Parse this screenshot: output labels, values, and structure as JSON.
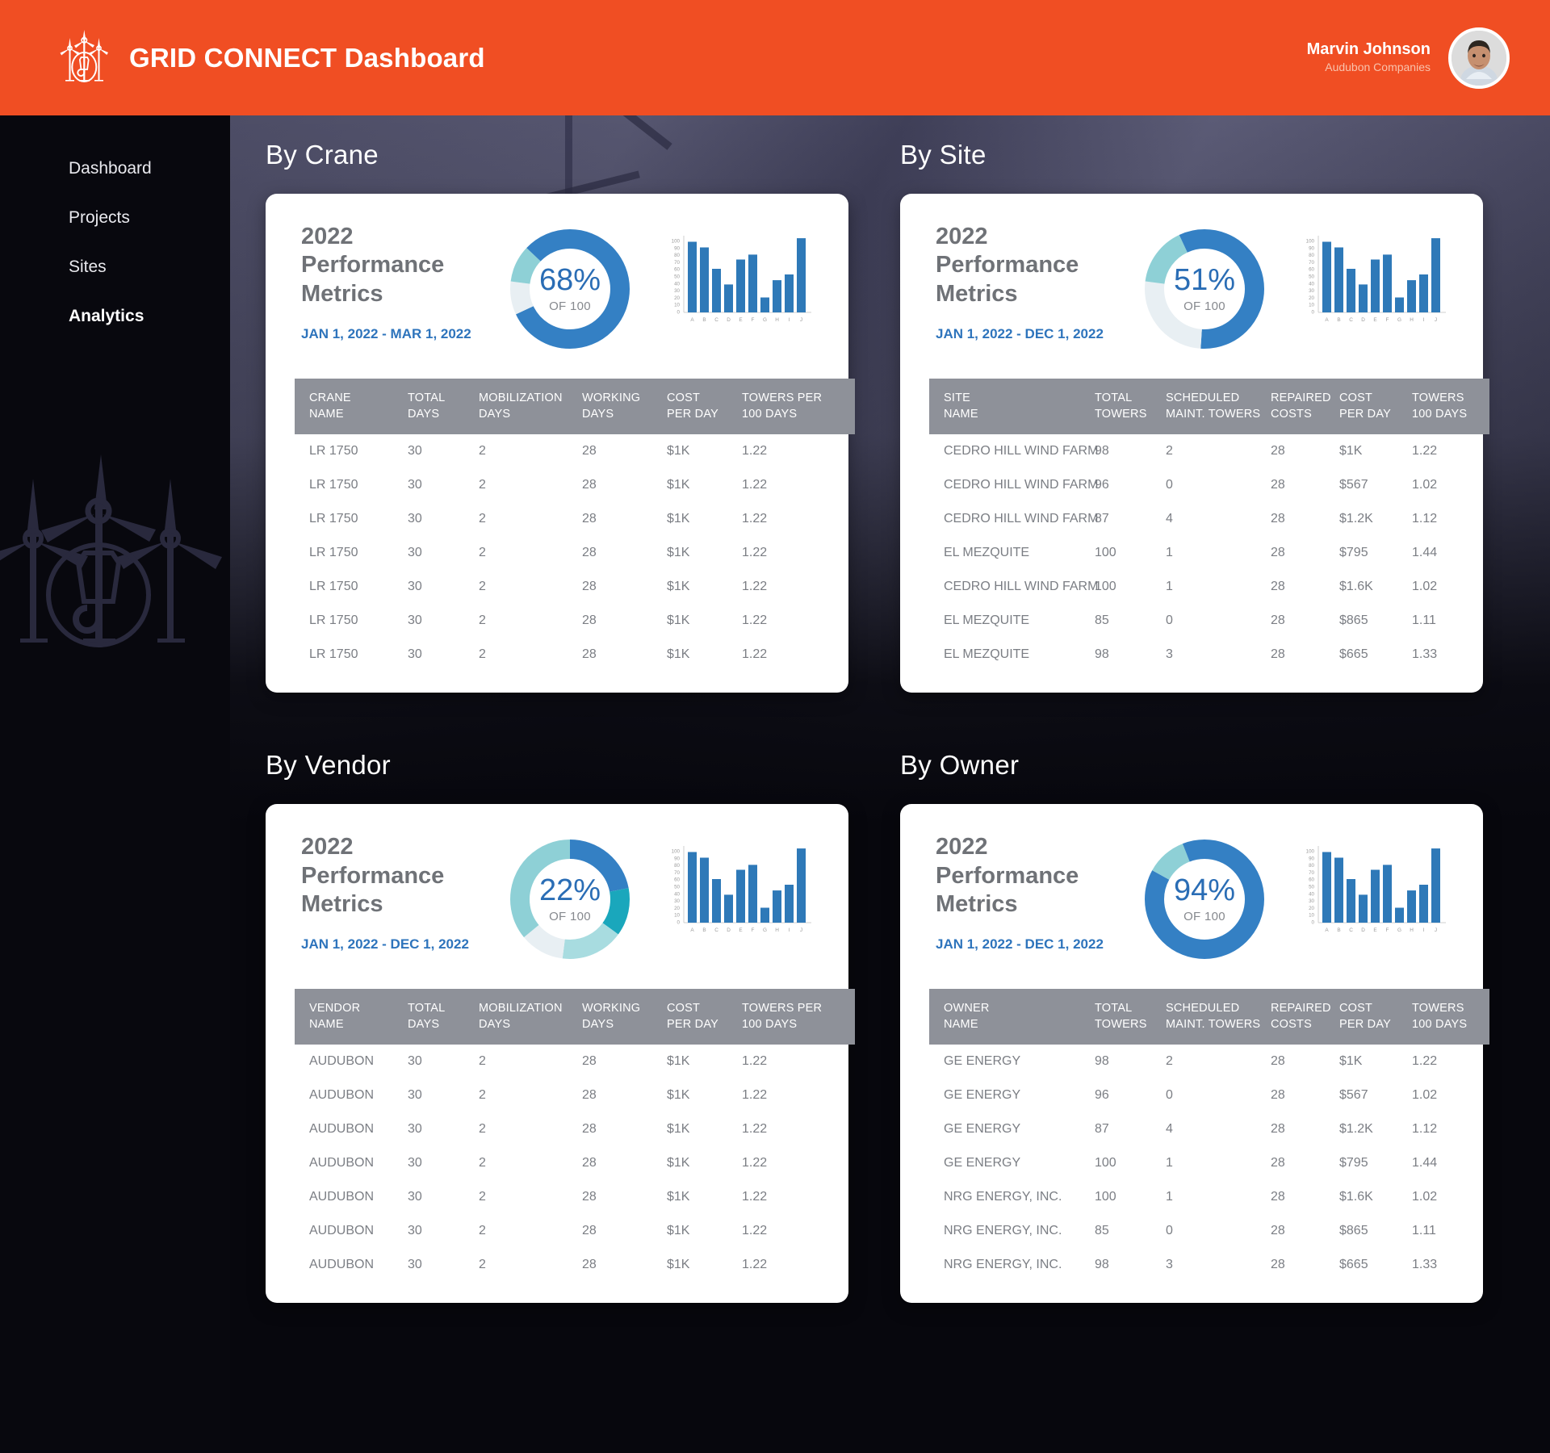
{
  "header": {
    "title": "GRID CONNECT Dashboard",
    "logo_icon": "wind-turbine-crane-logo",
    "user_name": "Marvin Johnson",
    "user_org": "Audubon Companies",
    "avatar_icon": "user-avatar-photo",
    "accent_color": "#f04e23"
  },
  "sidebar": {
    "items": [
      {
        "label": "Dashboard",
        "active": false
      },
      {
        "label": "Projects",
        "active": false
      },
      {
        "label": "Sites",
        "active": false
      },
      {
        "label": "Analytics",
        "active": true
      }
    ],
    "watermark_icon": "wind-turbine-crane-watermark"
  },
  "sections": {
    "crane": "By Crane",
    "site": "By Site",
    "vendor": "By Vendor",
    "owner": "By Owner"
  },
  "cards": {
    "crane": {
      "heading_line1": "2022",
      "heading_line2": "Performance",
      "heading_line3": "Metrics",
      "date_range": "JAN 1, 2022 - MAR 1, 2022",
      "donut_pct": "68%",
      "donut_sub": "OF 100",
      "columns": [
        {
          "l1": "CRANE",
          "l2": "NAME"
        },
        {
          "l1": "TOTAL",
          "l2": "DAYS"
        },
        {
          "l1": "MOBILIZATION",
          "l2": "DAYS"
        },
        {
          "l1": "WORKING",
          "l2": "DAYS"
        },
        {
          "l1": "COST",
          "l2": "PER DAY"
        },
        {
          "l1": "TOWERS PER",
          "l2": "100 DAYS"
        }
      ],
      "rows": [
        [
          "LR 1750",
          "30",
          "2",
          "28",
          "$1K",
          "1.22"
        ],
        [
          "LR 1750",
          "30",
          "2",
          "28",
          "$1K",
          "1.22"
        ],
        [
          "LR 1750",
          "30",
          "2",
          "28",
          "$1K",
          "1.22"
        ],
        [
          "LR 1750",
          "30",
          "2",
          "28",
          "$1K",
          "1.22"
        ],
        [
          "LR 1750",
          "30",
          "2",
          "28",
          "$1K",
          "1.22"
        ],
        [
          "LR 1750",
          "30",
          "2",
          "28",
          "$1K",
          "1.22"
        ],
        [
          "LR 1750",
          "30",
          "2",
          "28",
          "$1K",
          "1.22"
        ]
      ]
    },
    "site": {
      "heading_line1": "2022",
      "heading_line2": "Performance",
      "heading_line3": "Metrics",
      "date_range": "JAN 1, 2022 - DEC 1, 2022",
      "donut_pct": "51%",
      "donut_sub": "OF 100",
      "columns": [
        {
          "l1": "SITE",
          "l2": "NAME"
        },
        {
          "l1": "TOTAL",
          "l2": "TOWERS"
        },
        {
          "l1": "SCHEDULED",
          "l2": "MAINT. TOWERS"
        },
        {
          "l1": "REPAIRED",
          "l2": "COSTS"
        },
        {
          "l1": "COST",
          "l2": "PER DAY"
        },
        {
          "l1": "TOWERS",
          "l2": "100 DAYS"
        }
      ],
      "rows": [
        [
          "CEDRO HILL WIND FARM",
          "98",
          "2",
          "28",
          "$1K",
          "1.22"
        ],
        [
          "CEDRO HILL WIND FARM",
          "96",
          "0",
          "28",
          "$567",
          "1.02"
        ],
        [
          "CEDRO HILL WIND FARM",
          "87",
          "4",
          "28",
          "$1.2K",
          "1.12"
        ],
        [
          "EL MEZQUITE",
          "100",
          "1",
          "28",
          "$795",
          "1.44"
        ],
        [
          "CEDRO HILL WIND FARM",
          "100",
          "1",
          "28",
          "$1.6K",
          "1.02"
        ],
        [
          "EL MEZQUITE",
          "85",
          "0",
          "28",
          "$865",
          "1.11"
        ],
        [
          "EL MEZQUITE",
          "98",
          "3",
          "28",
          "$665",
          "1.33"
        ]
      ]
    },
    "vendor": {
      "heading_line1": "2022",
      "heading_line2": "Performance",
      "heading_line3": "Metrics",
      "date_range": "JAN 1, 2022 - DEC 1, 2022",
      "donut_pct": "22%",
      "donut_sub": "OF 100",
      "columns": [
        {
          "l1": "VENDOR",
          "l2": "NAME"
        },
        {
          "l1": "TOTAL",
          "l2": "DAYS"
        },
        {
          "l1": "MOBILIZATION",
          "l2": "DAYS"
        },
        {
          "l1": "WORKING",
          "l2": "DAYS"
        },
        {
          "l1": "COST",
          "l2": "PER DAY"
        },
        {
          "l1": "TOWERS PER",
          "l2": "100 DAYS"
        }
      ],
      "rows": [
        [
          "AUDUBON",
          "30",
          "2",
          "28",
          "$1K",
          "1.22"
        ],
        [
          "AUDUBON",
          "30",
          "2",
          "28",
          "$1K",
          "1.22"
        ],
        [
          "AUDUBON",
          "30",
          "2",
          "28",
          "$1K",
          "1.22"
        ],
        [
          "AUDUBON",
          "30",
          "2",
          "28",
          "$1K",
          "1.22"
        ],
        [
          "AUDUBON",
          "30",
          "2",
          "28",
          "$1K",
          "1.22"
        ],
        [
          "AUDUBON",
          "30",
          "2",
          "28",
          "$1K",
          "1.22"
        ],
        [
          "AUDUBON",
          "30",
          "2",
          "28",
          "$1K",
          "1.22"
        ]
      ]
    },
    "owner": {
      "heading_line1": "2022",
      "heading_line2": "Performance",
      "heading_line3": "Metrics",
      "date_range": "JAN 1, 2022 - DEC 1, 2022",
      "donut_pct": "94%",
      "donut_sub": "OF 100",
      "columns": [
        {
          "l1": "OWNER",
          "l2": "NAME"
        },
        {
          "l1": "TOTAL",
          "l2": "TOWERS"
        },
        {
          "l1": "SCHEDULED",
          "l2": "MAINT. TOWERS"
        },
        {
          "l1": "REPAIRED",
          "l2": "COSTS"
        },
        {
          "l1": "COST",
          "l2": "PER DAY"
        },
        {
          "l1": "TOWERS",
          "l2": "100 DAYS"
        }
      ],
      "rows": [
        [
          "GE ENERGY",
          "98",
          "2",
          "28",
          "$1K",
          "1.22"
        ],
        [
          "GE ENERGY",
          "96",
          "0",
          "28",
          "$567",
          "1.02"
        ],
        [
          "GE ENERGY",
          "87",
          "4",
          "28",
          "$1.2K",
          "1.12"
        ],
        [
          "GE ENERGY",
          "100",
          "1",
          "28",
          "$795",
          "1.44"
        ],
        [
          "NRG ENERGY, INC.",
          "100",
          "1",
          "28",
          "$1.6K",
          "1.02"
        ],
        [
          "NRG ENERGY, INC.",
          "85",
          "0",
          "28",
          "$865",
          "1.11"
        ],
        [
          "NRG ENERGY, INC.",
          "98",
          "3",
          "28",
          "$665",
          "1.33"
        ]
      ]
    }
  },
  "chart_data": [
    {
      "id": "crane-donut",
      "type": "pie",
      "title": "2022 Performance Metrics - By Crane",
      "center_label": "68%",
      "center_sublabel": "OF 100",
      "legend": "none",
      "slices": [
        {
          "name": "primary",
          "value": 68,
          "color": "#3480c4"
        },
        {
          "name": "secondary",
          "value": 9,
          "color": "#e8eff3"
        },
        {
          "name": "tertiary",
          "value": 10,
          "color": "#8ed0d6"
        },
        {
          "name": "quaternary",
          "value": 13,
          "color": "#3480c4"
        }
      ]
    },
    {
      "id": "crane-bars",
      "type": "bar",
      "categories": [
        "A",
        "B",
        "C",
        "D",
        "E",
        "F",
        "G",
        "H",
        "I",
        "J"
      ],
      "values": [
        100,
        92,
        62,
        40,
        75,
        82,
        21,
        46,
        54,
        105
      ],
      "title": "",
      "xlabel": "",
      "ylabel": "",
      "ylim": [
        0,
        110
      ],
      "ytick_labels": [
        "100",
        "90",
        "80",
        "70",
        "60",
        "50",
        "40",
        "30",
        "20",
        "10",
        "0"
      ],
      "grid": false,
      "bar_color": "#2e79b8"
    },
    {
      "id": "site-donut",
      "type": "pie",
      "title": "2022 Performance Metrics - By Site",
      "center_label": "51%",
      "center_sublabel": "OF 100",
      "legend": "none",
      "slices": [
        {
          "name": "primary",
          "value": 51,
          "color": "#3480c4"
        },
        {
          "name": "secondary",
          "value": 26,
          "color": "#e8eff3"
        },
        {
          "name": "tertiary",
          "value": 16,
          "color": "#8ed0d6"
        },
        {
          "name": "quaternary",
          "value": 7,
          "color": "#3480c4"
        }
      ]
    },
    {
      "id": "site-bars",
      "type": "bar",
      "categories": [
        "A",
        "B",
        "C",
        "D",
        "E",
        "F",
        "G",
        "H",
        "I",
        "J"
      ],
      "values": [
        100,
        92,
        62,
        40,
        75,
        82,
        21,
        46,
        54,
        105
      ],
      "ylim": [
        0,
        110
      ],
      "ytick_labels": [
        "100",
        "90",
        "80",
        "70",
        "60",
        "50",
        "40",
        "30",
        "20",
        "10",
        "0"
      ],
      "grid": false,
      "bar_color": "#2e79b8"
    },
    {
      "id": "vendor-donut",
      "type": "pie",
      "title": "2022 Performance Metrics - By Vendor",
      "center_label": "22%",
      "center_sublabel": "OF 100",
      "legend": "none",
      "slices": [
        {
          "name": "s1",
          "value": 22,
          "color": "#3480c4"
        },
        {
          "name": "s2",
          "value": 13,
          "color": "#1aa7bc"
        },
        {
          "name": "s3",
          "value": 17,
          "color": "#a8dce0"
        },
        {
          "name": "s4",
          "value": 12,
          "color": "#e8eff3"
        },
        {
          "name": "s5",
          "value": 36,
          "color": "#8ed0d6"
        }
      ]
    },
    {
      "id": "vendor-bars",
      "type": "bar",
      "categories": [
        "A",
        "B",
        "C",
        "D",
        "E",
        "F",
        "G",
        "H",
        "I",
        "J"
      ],
      "values": [
        100,
        92,
        62,
        40,
        75,
        82,
        21,
        46,
        54,
        105
      ],
      "ylim": [
        0,
        110
      ],
      "ytick_labels": [
        "100",
        "90",
        "80",
        "70",
        "60",
        "50",
        "40",
        "30",
        "20",
        "10",
        "0"
      ],
      "grid": false,
      "bar_color": "#2e79b8"
    },
    {
      "id": "owner-donut",
      "type": "pie",
      "title": "2022 Performance Metrics - By Owner",
      "center_label": "94%",
      "center_sublabel": "OF 100",
      "legend": "none",
      "slices": [
        {
          "name": "primary",
          "value": 83,
          "color": "#3480c4"
        },
        {
          "name": "secondary",
          "value": 11,
          "color": "#8ed0d6"
        },
        {
          "name": "tertiary",
          "value": 6,
          "color": "#3480c4"
        }
      ]
    },
    {
      "id": "owner-bars",
      "type": "bar",
      "categories": [
        "A",
        "B",
        "C",
        "D",
        "E",
        "F",
        "G",
        "H",
        "I",
        "J"
      ],
      "values": [
        100,
        92,
        62,
        40,
        75,
        82,
        21,
        46,
        54,
        105
      ],
      "ylim": [
        0,
        110
      ],
      "ytick_labels": [
        "100",
        "90",
        "80",
        "70",
        "60",
        "50",
        "40",
        "30",
        "20",
        "10",
        "0"
      ],
      "grid": false,
      "bar_color": "#2e79b8"
    }
  ]
}
